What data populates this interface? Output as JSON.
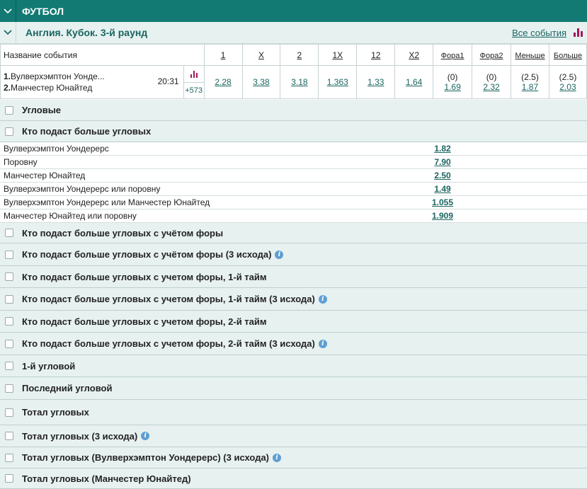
{
  "header": {
    "sport": "ФУТБОЛ"
  },
  "league": {
    "title": "Англия. Кубок. 3-й раунд",
    "all_events": "Все события"
  },
  "columns": {
    "name": "Название события",
    "c1": "1",
    "cx": "X",
    "c2": "2",
    "c1x": "1X",
    "c12": "12",
    "cx2": "X2",
    "fora1": "Фора1",
    "fora2": "Фора2",
    "less": "Меньше",
    "more": "Больше"
  },
  "event": {
    "team1_num": "1.",
    "team1": "Вулверхэмптон Уонде...",
    "team2_num": "2.",
    "team2": "Манчестер Юнайтед",
    "time": "20:31",
    "more_count": "+573",
    "odds": {
      "c1": "2.28",
      "cx": "3.38",
      "c2": "3.18",
      "c1x": "1.363",
      "c12": "1.33",
      "cx2": "1.64"
    },
    "fora1": {
      "line": "(0)",
      "val": "1.69"
    },
    "fora2": {
      "line": "(0)",
      "val": "2.32"
    },
    "less": {
      "line": "(2.5)",
      "val": "1.87"
    },
    "more": {
      "line": "(2.5)",
      "val": "2.03"
    }
  },
  "markets": [
    "Угловые",
    "Кто подаст больше угловых",
    "Кто подаст больше угловых с учётом форы",
    "Кто подаст больше угловых с учётом форы (3 исхода)",
    "Кто подаст больше угловых с учетом форы, 1-й тайм",
    "Кто подаст больше угловых с учетом форы, 1-й тайм (3 исхода)",
    "Кто подаст больше угловых с учетом форы, 2-й тайм",
    "Кто подаст больше угловых с учетом форы, 2-й тайм (3 исхода)",
    "1-й угловой",
    "Последний угловой",
    "Тотал угловых",
    "Тотал угловых (3 исхода)",
    "Тотал угловых (Вулверхэмптон Уондерерс) (3 исхода)",
    "Тотал угловых (Манчестер Юнайтед)"
  ],
  "selections": [
    {
      "name": "Вулверхэмптон Уондерерс",
      "value": "1.82"
    },
    {
      "name": "Поровну",
      "value": "7.90"
    },
    {
      "name": "Манчестер Юнайтед",
      "value": "2.50"
    },
    {
      "name": "Вулверхэмптон Уондерерс или поровну",
      "value": "1.49"
    },
    {
      "name": "Вулверхэмптон Уондерерс или Манчестер Юнайтед",
      "value": "1.055"
    },
    {
      "name": "Манчестер Юнайтед или поровну",
      "value": "1.909"
    }
  ],
  "colors": {
    "header": "#127a73",
    "accent": "#1a6560",
    "stats_icon": "#a3175b",
    "info_icon": "#5f9ed1"
  },
  "icons": [
    "chevron-down-icon",
    "bar-chart-icon",
    "info-icon",
    "checkbox-icon"
  ]
}
